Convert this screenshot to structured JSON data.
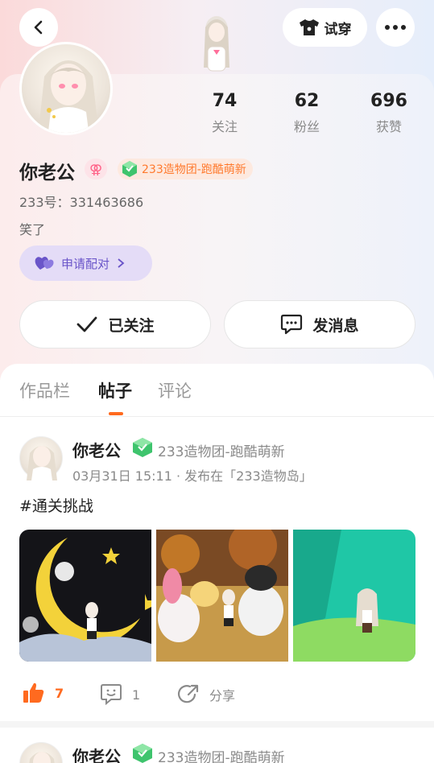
{
  "header": {
    "tryon_label": "试穿"
  },
  "profile": {
    "stats": [
      {
        "value": "74",
        "label": "关注"
      },
      {
        "value": "62",
        "label": "粉丝"
      },
      {
        "value": "696",
        "label": "获赞"
      }
    ],
    "name": "你老公",
    "group_badge": "233造物团-跑酷萌新",
    "uid": "233号：331463686",
    "bio": "笑了",
    "pair_label": "申请配对"
  },
  "buttons": {
    "follow_label": "已关注",
    "message_label": "发消息"
  },
  "tabs": [
    {
      "label": "作品栏"
    },
    {
      "label": "帖子"
    },
    {
      "label": "评论"
    }
  ],
  "posts": [
    {
      "author": "你老公",
      "group": "233造物团-跑酷萌新",
      "meta": "03月31日 15:11 · 发布在「233造物岛」",
      "text": "#通关挑战",
      "likes": "7",
      "comments": "1",
      "share_label": "分享"
    },
    {
      "author": "你老公",
      "group": "233造物团-跑酷萌新"
    }
  ],
  "colors": {
    "accent": "#ff6a1f",
    "pair": "#6a55c9"
  }
}
